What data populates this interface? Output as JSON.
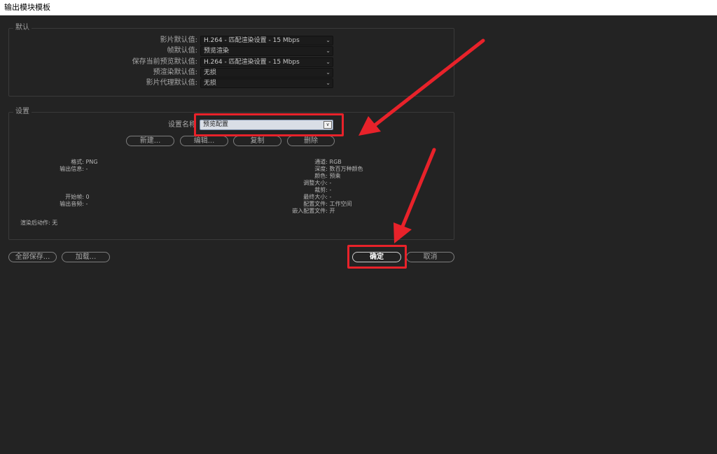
{
  "window": {
    "title": "输出模块模板"
  },
  "defaults": {
    "legend": "默认",
    "rows": [
      {
        "label": "影片默认值:",
        "value": "H.264 - 匹配渲染设置 - 15 Mbps"
      },
      {
        "label": "帧默认值:",
        "value": "预览渲染"
      },
      {
        "label": "保存当前预览默认值:",
        "value": "H.264 - 匹配渲染设置 - 15 Mbps"
      },
      {
        "label": "预渲染默认值:",
        "value": "无损"
      },
      {
        "label": "影片代理默认值:",
        "value": "无损"
      }
    ]
  },
  "settings": {
    "legend": "设置",
    "preset_label": "设置名称",
    "preset_value": "预览配置",
    "buttons": {
      "new": "新建...",
      "edit": "编辑...",
      "duplicate": "复制",
      "delete": "删除"
    },
    "left_info": [
      {
        "label": "格式:",
        "value": "PNG"
      },
      {
        "label": "输出信息:",
        "value": "-"
      },
      {
        "label": "开始帧:",
        "value": "0"
      },
      {
        "label": "输出音频:",
        "value": "-"
      }
    ],
    "right_info": [
      {
        "label": "通道:",
        "value": "RGB"
      },
      {
        "label": "深度:",
        "value": "数百万种颜色"
      },
      {
        "label": "颜色:",
        "value": "预乘"
      },
      {
        "label": "调整大小:",
        "value": "-"
      },
      {
        "label": "裁剪:",
        "value": "-"
      },
      {
        "label": "最终大小:",
        "value": "-"
      },
      {
        "label": "配置文件:",
        "value": "工作空间"
      },
      {
        "label": "嵌入配置文件:",
        "value": "开"
      }
    ],
    "post_render": {
      "label": "渲染后动作:",
      "value": "无"
    }
  },
  "footer": {
    "save_all": "全部保存...",
    "load": "加载...",
    "ok": "确定",
    "cancel": "取消"
  },
  "annotation": {
    "color": "#e8222a"
  }
}
